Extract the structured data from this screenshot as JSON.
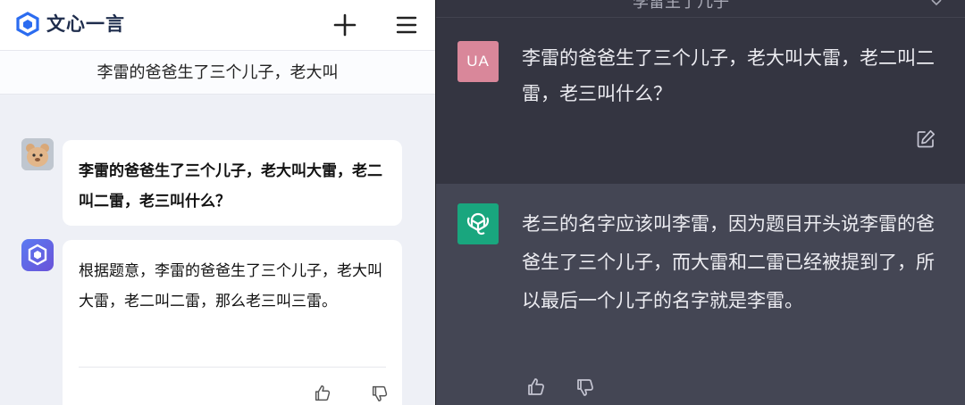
{
  "left_app": {
    "app_name": "文心一言",
    "conversation_title": "李雷的爸爸生了三个儿子，老大叫",
    "user_message": "李雷的爸爸生了三个儿子，老大叫大雷，老二叫二雷，老三叫什么？",
    "bot_message": "根据题意，李雷的爸爸生了三个儿子，老大叫大雷，老二叫二雷，那么老三叫三雷。",
    "icons": {
      "logo": "ernie-logo-icon",
      "new_chat": "plus-icon",
      "menu": "hamburger-menu-icon",
      "like": "thumbs-up-icon",
      "dislike": "thumbs-down-icon"
    },
    "colors": {
      "brand": "#1f2d4d",
      "bot_avatar": "#5a7bf2",
      "bg": "#eef0f6"
    }
  },
  "right_app": {
    "top_title": "李雷生了几子",
    "user_avatar_initials": "UA",
    "user_message": "李雷的爸爸生了三个儿子，老大叫大雷，老二叫二雷，老三叫什么？",
    "bot_message": "老三的名字应该叫李雷，因为题目开头说李雷的爸爸生了三个儿子，而大雷和二雷已经被提到了，所以最后一个儿子的名字就是李雷。",
    "icons": {
      "bot_avatar": "openai-logo-icon",
      "edit": "edit-icon",
      "like": "thumbs-up-icon",
      "dislike": "thumbs-down-icon",
      "chevron": "chevron-down-icon"
    },
    "colors": {
      "bg": "#343541",
      "bot_row": "#444654",
      "user_avatar": "#d9879a",
      "bot_avatar": "#19a67e"
    }
  }
}
